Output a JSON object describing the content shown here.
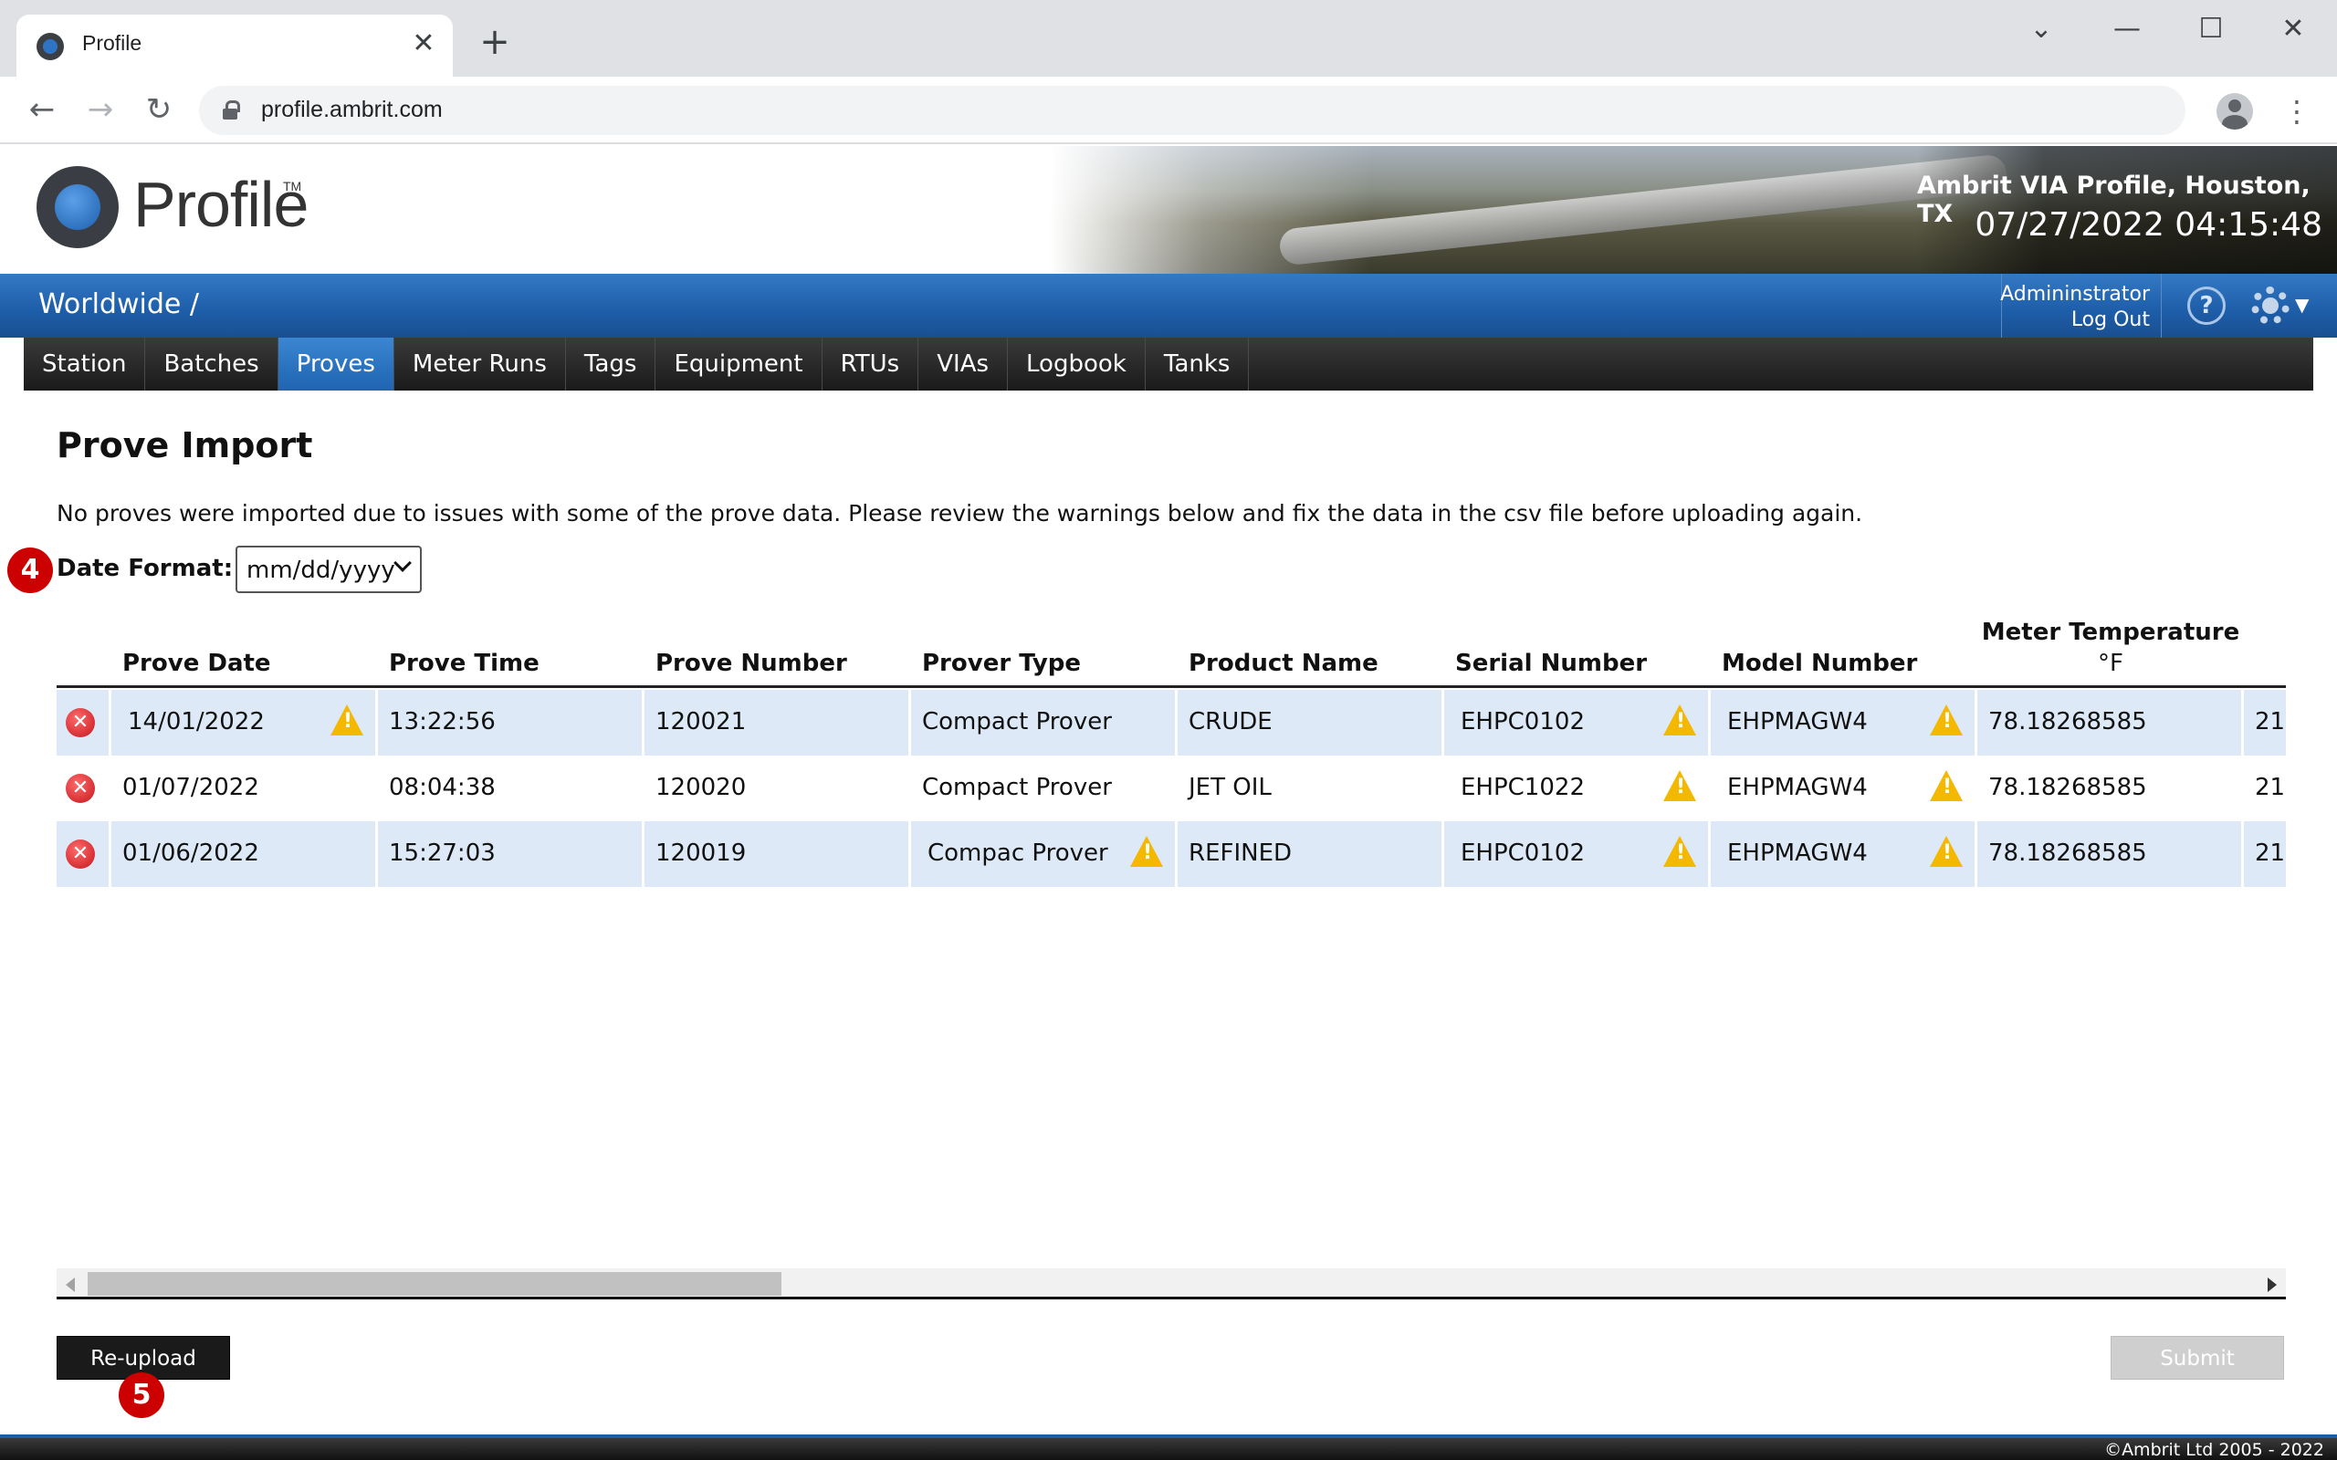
{
  "browser": {
    "tab_title": "Profile",
    "tab_close": "✕",
    "new_tab": "+",
    "url": "profile.ambrit.com",
    "controls": {
      "minimize": "—",
      "maximize": "☐",
      "close": "✕",
      "tab_list": "⌄"
    },
    "nav": {
      "back": "←",
      "forward": "→",
      "reload": "↻"
    },
    "menu": "⋮"
  },
  "header": {
    "logo_text": "Profile",
    "logo_tm": "TM",
    "site_name": "Ambrit VIA Profile, Houston, TX",
    "datetime": "07/27/2022 04:15:48"
  },
  "bluebar": {
    "breadcrumb": "Worldwide /",
    "user": "Admininstrator",
    "logout": "Log Out",
    "help": "?",
    "caret": "▼"
  },
  "menu": {
    "items": [
      {
        "label": "Station"
      },
      {
        "label": "Batches"
      },
      {
        "label": "Proves"
      },
      {
        "label": "Meter Runs"
      },
      {
        "label": "Tags"
      },
      {
        "label": "Equipment"
      },
      {
        "label": "RTUs"
      },
      {
        "label": "VIAs"
      },
      {
        "label": "Logbook"
      },
      {
        "label": "Tanks"
      }
    ],
    "active": "Proves"
  },
  "page": {
    "title": "Prove Import",
    "message": "No proves were imported due to issues with some of the prove data. Please review the warnings below and fix the data in the csv file before uploading again.",
    "date_format_label": "Date Format:",
    "date_format_value": "mm/dd/yyyy",
    "badges": [
      "4",
      "5"
    ]
  },
  "table": {
    "headers": {
      "prove_date": "Prove Date",
      "prove_time": "Prove Time",
      "prove_number": "Prove Number",
      "prover_type": "Prover Type",
      "product_name": "Product Name",
      "serial_number": "Serial Number",
      "model_number": "Model Number",
      "meter_temp_line1": "Meter Temperature",
      "meter_temp_line2": "°F"
    },
    "rows": [
      {
        "prove_date": "14/01/2022",
        "prove_time": "13:22:56",
        "prove_number": "120021",
        "prover_type": "Compact Prover",
        "product_name": "CRUDE",
        "serial_number": "EHPC0102",
        "model_number": "EHPMAGW4",
        "meter_temp": "78.18268585",
        "next_col": "21",
        "warn_date": true,
        "warn_prover": false
      },
      {
        "prove_date": "01/07/2022",
        "prove_time": "08:04:38",
        "prove_number": "120020",
        "prover_type": "Compact Prover",
        "product_name": "JET OIL",
        "serial_number": "EHPC1022",
        "model_number": "EHPMAGW4",
        "meter_temp": "78.18268585",
        "next_col": "21",
        "warn_date": false,
        "warn_prover": false
      },
      {
        "prove_date": "01/06/2022",
        "prove_time": "15:27:03",
        "prove_number": "120019",
        "prover_type": "Compac Prover",
        "product_name": "REFINED",
        "serial_number": "EHPC0102",
        "model_number": "EHPMAGW4",
        "meter_temp": "78.18268585",
        "next_col": "21",
        "warn_date": false,
        "warn_prover": true
      }
    ],
    "error_glyph": "✕"
  },
  "actions": {
    "reupload": "Re-upload",
    "submit": "Submit"
  },
  "footer": {
    "copyright": "©Ambrit Ltd 2005 - 2022"
  },
  "colors": {
    "nav_blue": "#1d5da8",
    "row_shade": "#dde9f7",
    "badge_red": "#c00000",
    "warn_yellow": "#f5b800"
  }
}
